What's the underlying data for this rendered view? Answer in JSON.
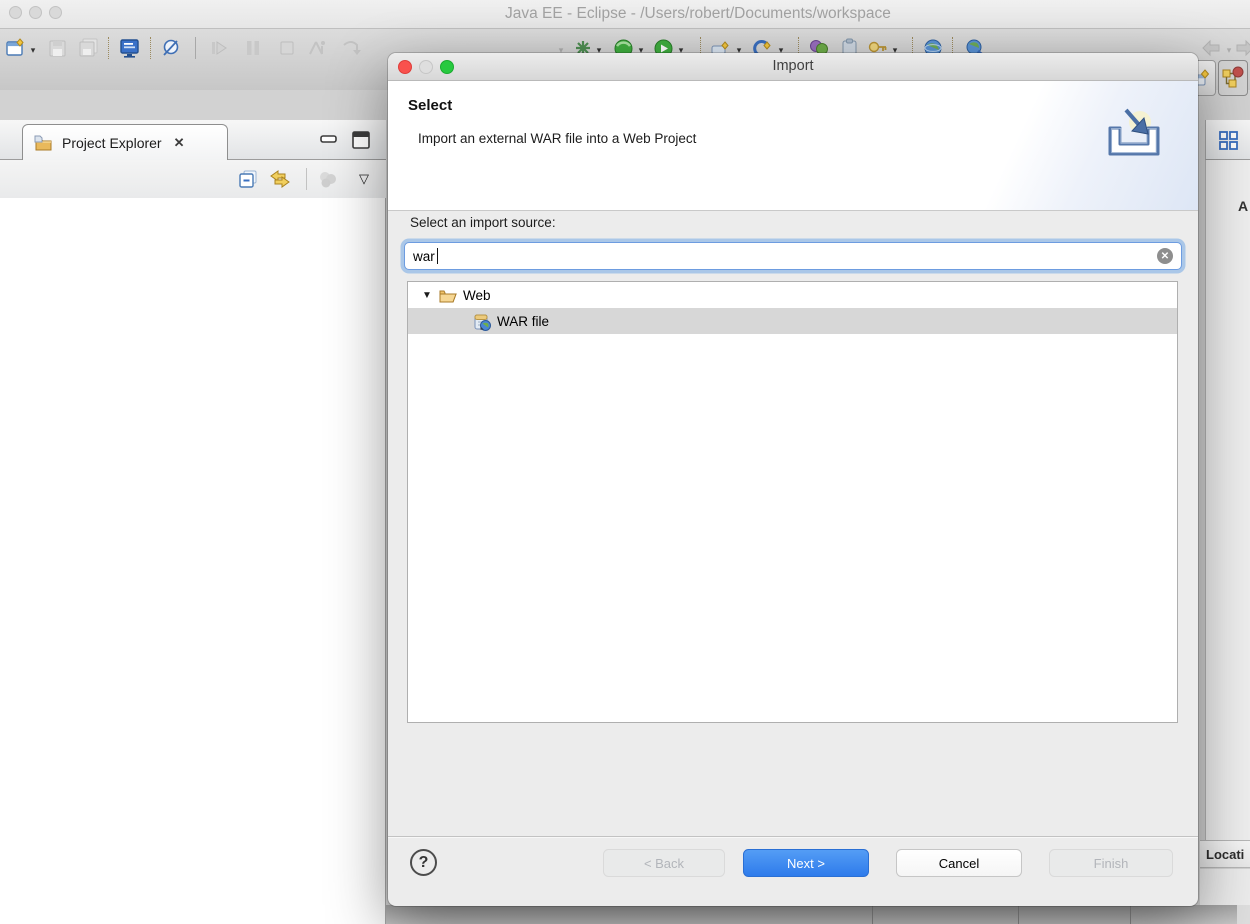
{
  "window": {
    "title": "Java EE - Eclipse - /Users/robert/Documents/workspace"
  },
  "toolbar": {
    "icon_names": [
      "new-wizard",
      "save",
      "save-all",
      "console",
      "skip-breakpoints",
      "resume",
      "pause",
      "terminate",
      "step-into",
      "step-over",
      "text-lines",
      "pin-editor",
      "debug",
      "run",
      "new-server-wizard",
      "new-web-wizard",
      "java-package",
      "clipboard",
      "key",
      "web-browser",
      "web-search",
      "back-arrow",
      "forward-arrow"
    ]
  },
  "perspectives": {
    "active": "java-ee-perspective"
  },
  "project_explorer": {
    "tab_label": "Project Explorer"
  },
  "right_panel": {
    "partial_text": "A"
  },
  "markers": {
    "location_header": "Locati"
  },
  "icons": {
    "dropdown": "▾",
    "disclosure_expanded": "▼",
    "view_menu_chevron": "▽",
    "close": "✕",
    "clear": "✕",
    "help": "?"
  },
  "dialog": {
    "title": "Import",
    "heading": "Select",
    "description": "Import an external WAR file into a Web Project",
    "source_label": "Select an import source:",
    "filter": {
      "value": "war",
      "placeholder": ""
    },
    "tree": {
      "items": [
        {
          "label": "Web",
          "level": 0,
          "expanded": true,
          "selected": false
        },
        {
          "label": "WAR file",
          "level": 1,
          "expanded": false,
          "selected": true
        }
      ]
    },
    "footer": {
      "back": "< Back",
      "next": "Next >",
      "cancel": "Cancel",
      "finish": "Finish"
    }
  },
  "colors": {
    "accent_blue": "#3b82e8",
    "focus_ring": "#74a9e6",
    "selection_gray": "#d7d7d7",
    "traffic_red": "#f9514d",
    "traffic_green": "#27c93f",
    "disabled_text": "#b2b5ba"
  }
}
